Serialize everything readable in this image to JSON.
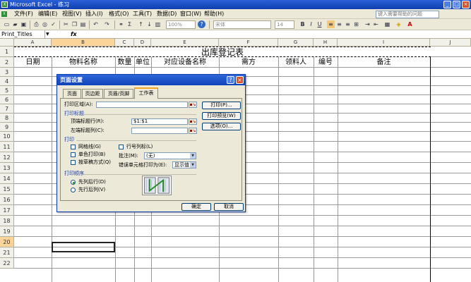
{
  "window": {
    "title": "Microsoft Excel - 练习",
    "app_icon": "excel-icon",
    "min": "_",
    "max": "□",
    "close": "×"
  },
  "menu": [
    "文件(F)",
    "编辑(E)",
    "视图(V)",
    "插入(I)",
    "格式(O)",
    "工具(T)",
    "数据(D)",
    "窗口(W)",
    "帮助(H)"
  ],
  "help_placeholder": "键入需要帮助的问题",
  "toolbar": {
    "zoom": "100%",
    "font": "宋体",
    "size": "14"
  },
  "formula": {
    "name_box": "Print_Titles",
    "fx": "fx"
  },
  "columns": [
    "A",
    "B",
    "C",
    "D",
    "E",
    "F",
    "G",
    "H",
    "I",
    "J"
  ],
  "rows": [
    "1",
    "2",
    "3",
    "4",
    "5",
    "6",
    "7",
    "8",
    "9",
    "10",
    "11",
    "12",
    "13",
    "14",
    "15",
    "16",
    "17",
    "18",
    "19",
    "20",
    "21",
    "22"
  ],
  "sheet": {
    "title": "出库登记表",
    "headers": [
      "日期",
      "物料名称",
      "数量",
      "单位",
      "对应设备名称",
      "需方",
      "领料人",
      "编号",
      "备注"
    ]
  },
  "dialog": {
    "title": "页面设置",
    "tabs": [
      "页面",
      "页边距",
      "页眉/页脚",
      "工作表"
    ],
    "print_area_label": "打印区域(A):",
    "print_area_value": "",
    "print_titles_group": "打印标题",
    "top_rows_label": "顶端标题行(R):",
    "top_rows_value": "$1:$1",
    "left_cols_label": "左端标题列(C):",
    "left_cols_value": "",
    "print_group": "打印",
    "gridlines": "网格线(G)",
    "mono": "单色打印(B)",
    "draft": "按草稿方式(Q)",
    "rowcol": "行号列标(L)",
    "comments_label": "批注(M):",
    "comments_value": "(无)",
    "errors_label": "错误单元格打印为(E):",
    "errors_value": "显示值",
    "order_group": "打印顺序",
    "down_then_over": "先列后行(D)",
    "over_then_down": "先行后列(V)",
    "print_btn": "打印(P)...",
    "preview_btn": "打印预览(W)",
    "options_btn": "选项(O)...",
    "ok": "确定",
    "cancel": "取消",
    "help": "?",
    "close": "×"
  }
}
